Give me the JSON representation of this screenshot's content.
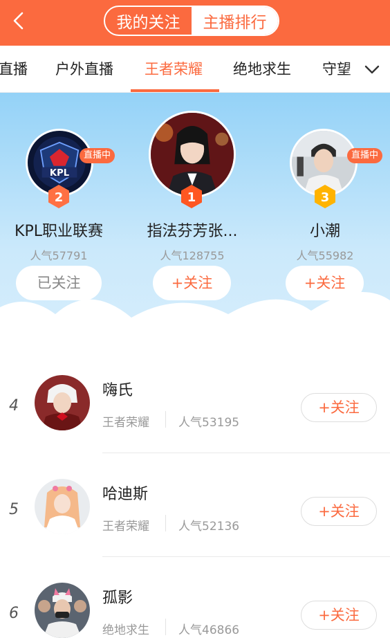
{
  "header": {
    "tabs": [
      {
        "label": "我的关注"
      },
      {
        "label": "主播排行"
      }
    ],
    "active_tab": "主播排行"
  },
  "categories": {
    "items": [
      {
        "label": "直播"
      },
      {
        "label": "户外直播"
      },
      {
        "label": "王者荣耀"
      },
      {
        "label": "绝地求生"
      },
      {
        "label": "守望"
      }
    ],
    "active": "王者荣耀"
  },
  "podium": [
    {
      "rank": "2",
      "name": "KPL职业联赛",
      "popularity": "人气57791",
      "live_label": "直播中",
      "button": "已关注",
      "followed": true
    },
    {
      "rank": "1",
      "name": "指法芬芳张...",
      "popularity": "人气128755",
      "live_label": "",
      "button": "+关注",
      "followed": false
    },
    {
      "rank": "3",
      "name": "小潮",
      "popularity": "人气55982",
      "live_label": "直播中",
      "button": "+关注",
      "followed": false
    }
  ],
  "list": [
    {
      "rank": "4",
      "name": "嗨氏",
      "category": "王者荣耀",
      "popularity": "人气53195",
      "button": "+关注"
    },
    {
      "rank": "5",
      "name": "哈迪斯",
      "category": "王者荣耀",
      "popularity": "人气52136",
      "button": "+关注"
    },
    {
      "rank": "6",
      "name": "孤影",
      "category": "绝地求生",
      "popularity": "人气46866",
      "button": "+关注"
    }
  ],
  "colors": {
    "accent": "#fb6a3f",
    "sky": "#94d2f7",
    "rank1": "#ff5722",
    "rank2": "#ff7043",
    "rank3": "#ffb300"
  },
  "icons": {
    "back": "back-arrow-icon",
    "more": "chevron-down-icon"
  }
}
